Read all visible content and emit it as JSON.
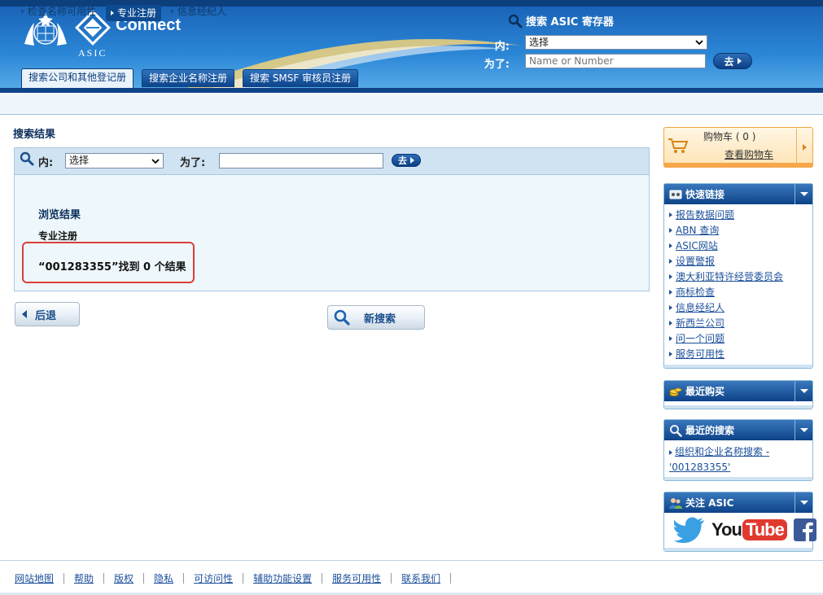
{
  "header": {
    "brand_name": "Connect",
    "agency": "ASIC",
    "search_title": "搜索 ASIC 寄存器",
    "in_label": "内:",
    "for_label": "为了:",
    "select_value": "选择",
    "input_placeholder": "Name or Number",
    "go_label": "去"
  },
  "tabs": [
    {
      "label": "搜索公司和其他登记册",
      "active": true
    },
    {
      "label": "搜索企业名称注册",
      "active": false
    },
    {
      "label": "搜索 SMSF 审核员注册",
      "active": false
    }
  ],
  "subnav": [
    {
      "label": "检查名称可用性",
      "active": false
    },
    {
      "label": "专业注册",
      "active": true
    },
    {
      "label": "信息经纪人",
      "active": false
    }
  ],
  "main": {
    "page_title": "搜索结果",
    "search": {
      "in_label": "内:",
      "select_value": "选择",
      "for_label": "为了:",
      "input_value": "",
      "go_label": "去"
    },
    "browse_title": "浏览结果",
    "register_type": "专业注册",
    "result_message": "“001283355”找到 0 个结果",
    "back_label": "后退",
    "new_search_label": "新搜索"
  },
  "sidebar": {
    "cart": {
      "count_label": "购物车 ( 0 )",
      "view_label": "查看购物车"
    },
    "quick_links": {
      "title": "快速链接",
      "items": [
        "报告数据问题",
        "ABN 查询",
        "ASIC网站",
        "设置警报",
        "澳大利亚特许经营委员会",
        "商标检查",
        "信息经纪人",
        "新西兰公司",
        "问一个问题",
        "服务可用性"
      ]
    },
    "recent_purchases": {
      "title": "最近购买"
    },
    "recent_searches": {
      "title": "最近的搜索",
      "items": [
        "组织和企业名称搜索 -",
        "'001283355'"
      ]
    },
    "follow": {
      "title": "关注 ASIC",
      "youtube_you": "You",
      "youtube_tube": "Tube"
    }
  },
  "footer": {
    "links": [
      "网站地图",
      "帮助",
      "版权",
      "隐私",
      "可访问性",
      "辅助功能设置",
      "服务可用性",
      "联系我们"
    ]
  },
  "colors": {
    "header_blue": "#1a64b8",
    "nav_dark": "#0d4388",
    "highlight_red": "#d9403a",
    "cart_orange": "#f7a64a",
    "link_blue": "#1b4f9a"
  }
}
